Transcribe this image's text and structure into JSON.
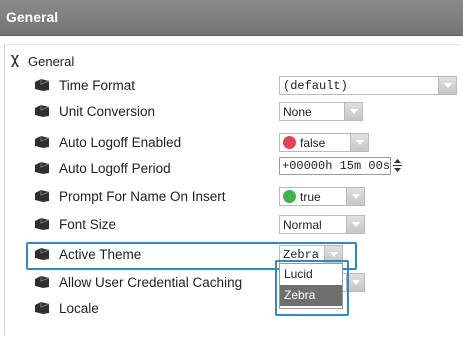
{
  "header": {
    "title": "General"
  },
  "tree": {
    "root_label": "General",
    "properties": [
      {
        "label": "Time Format",
        "value": "(default)"
      },
      {
        "label": "Unit Conversion",
        "value": "None"
      },
      {
        "label": "Auto Logoff Enabled",
        "value": "false",
        "status_color": "#e4434e"
      },
      {
        "label": "Auto Logoff Period",
        "value": "+00000h 15m 00s"
      },
      {
        "label": "Prompt For Name On Insert",
        "value": "true",
        "status_color": "#3bb54a"
      },
      {
        "label": "Font Size",
        "value": "Normal"
      },
      {
        "label": "Active Theme",
        "value": "Zebra"
      },
      {
        "label": "Allow User Credential Caching",
        "value": ""
      },
      {
        "label": "Locale",
        "value": ""
      }
    ]
  },
  "theme_dropdown": {
    "options": [
      "Lucid",
      "Zebra"
    ],
    "selected": "Zebra"
  },
  "colors": {
    "accent_highlight": "#2b8cc4",
    "header_bg": "#7f7f7f",
    "selected_option_bg": "#6f6f6f"
  }
}
